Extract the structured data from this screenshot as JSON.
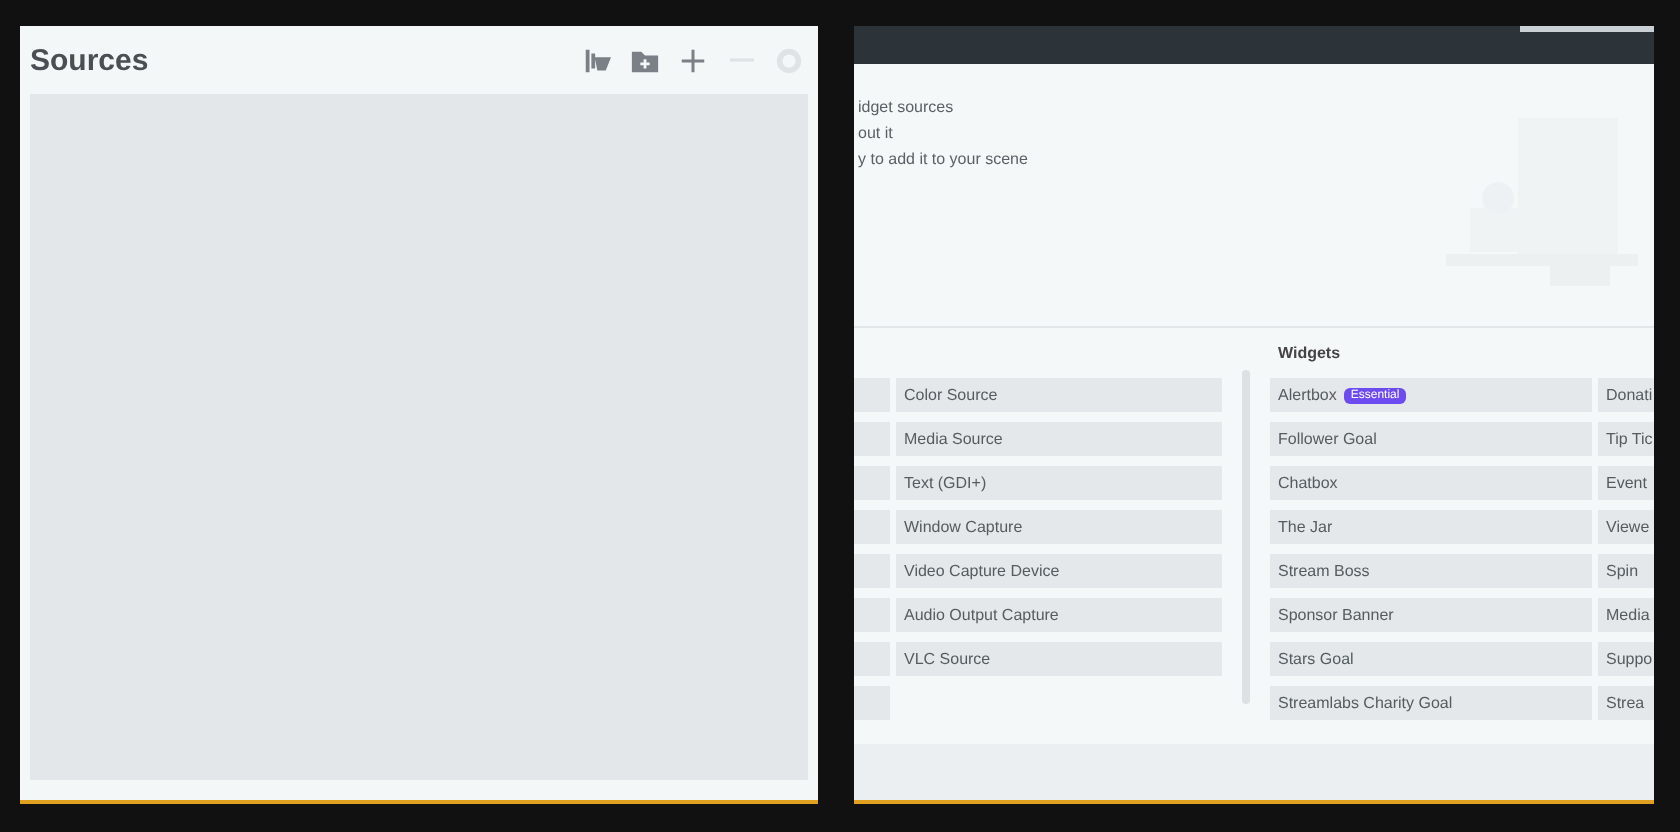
{
  "sources_panel": {
    "title": "Sources",
    "tools": [
      {
        "kind": "filter",
        "disabled": false
      },
      {
        "kind": "folder",
        "disabled": false
      },
      {
        "kind": "add",
        "disabled": false
      },
      {
        "kind": "remove",
        "disabled": true
      },
      {
        "kind": "settings",
        "disabled": true
      }
    ]
  },
  "add_source_window": {
    "intro_lines": [
      "idget sources",
      "out it",
      "y to add it to your scene"
    ],
    "columns": [
      {
        "cells": [
          {},
          {},
          {},
          {},
          {},
          {},
          {},
          {}
        ]
      },
      {
        "cells": [
          {
            "label": "Color Source"
          },
          {
            "label": "Media Source"
          },
          {
            "label": "Text (GDI+)"
          },
          {
            "label": "Window Capture"
          },
          {
            "label": "Video Capture Device"
          },
          {
            "label": "Audio Output Capture"
          },
          {
            "label": "VLC Source"
          }
        ]
      },
      {
        "heading": "Widgets",
        "cells": [
          {
            "label": "Alertbox",
            "badge": "Essential"
          },
          {
            "label": "Follower Goal"
          },
          {
            "label": "Chatbox"
          },
          {
            "label": "The Jar"
          },
          {
            "label": "Stream Boss"
          },
          {
            "label": "Sponsor Banner"
          },
          {
            "label": "Stars Goal"
          },
          {
            "label": "Streamlabs Charity Goal"
          }
        ]
      },
      {
        "cells": [
          {
            "label": "Donati"
          },
          {
            "label": "Tip Tic"
          },
          {
            "label": "Event"
          },
          {
            "label": "Viewe"
          },
          {
            "label": "Spin"
          },
          {
            "label": "Media"
          },
          {
            "label": "Suppo"
          },
          {
            "label": "Strea"
          }
        ]
      }
    ]
  }
}
